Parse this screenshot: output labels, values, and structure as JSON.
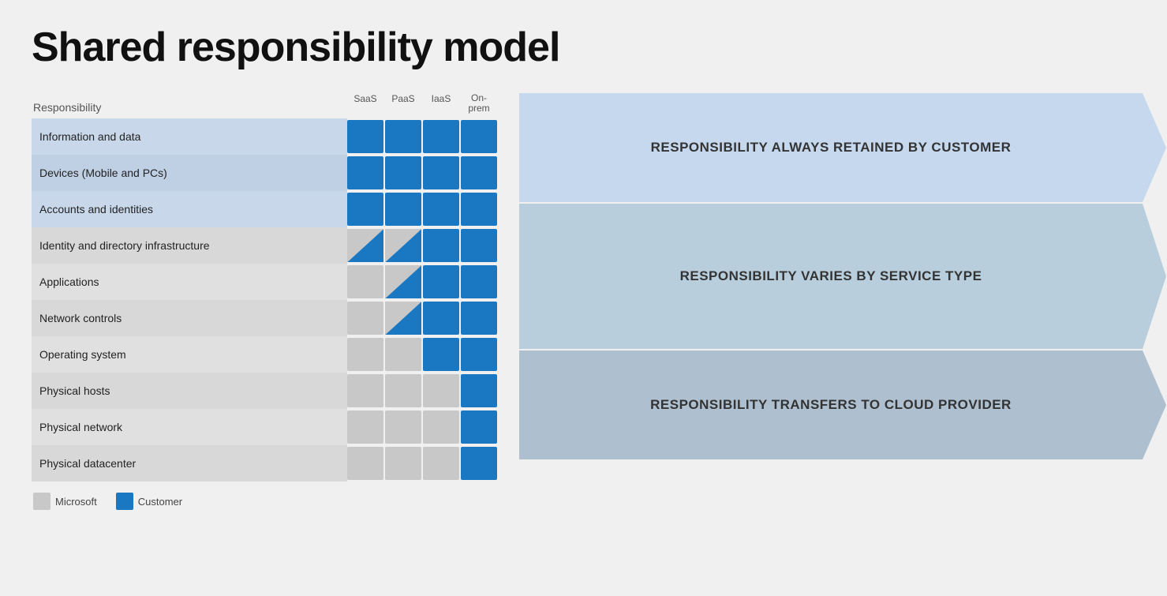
{
  "title": "Shared responsibility model",
  "table": {
    "header": {
      "responsibility_label": "Responsibility",
      "columns": [
        "SaaS",
        "PaaS",
        "IaaS",
        "On-\nprem"
      ]
    },
    "rows": [
      {
        "label": "Information and data",
        "cells": [
          "blue",
          "blue",
          "blue",
          "blue"
        ],
        "bg": "light-blue"
      },
      {
        "label": "Devices (Mobile and PCs)",
        "cells": [
          "blue",
          "blue",
          "blue",
          "blue"
        ],
        "bg": "light-blue"
      },
      {
        "label": "Accounts and identities",
        "cells": [
          "blue",
          "blue",
          "blue",
          "blue"
        ],
        "bg": "light-blue"
      },
      {
        "label": "Identity and directory infrastructure",
        "cells": [
          "half",
          "half",
          "blue",
          "blue"
        ],
        "bg": "light-gray"
      },
      {
        "label": "Applications",
        "cells": [
          "gray",
          "half",
          "blue",
          "blue"
        ],
        "bg": "light-gray"
      },
      {
        "label": "Network controls",
        "cells": [
          "gray",
          "half",
          "blue",
          "blue"
        ],
        "bg": "light-gray"
      },
      {
        "label": "Operating system",
        "cells": [
          "gray",
          "gray",
          "blue",
          "blue"
        ],
        "bg": "light-gray"
      },
      {
        "label": "Physical hosts",
        "cells": [
          "gray",
          "gray",
          "gray",
          "blue"
        ],
        "bg": "light-gray"
      },
      {
        "label": "Physical network",
        "cells": [
          "gray",
          "gray",
          "gray",
          "blue"
        ],
        "bg": "light-gray"
      },
      {
        "label": "Physical datacenter",
        "cells": [
          "gray",
          "gray",
          "gray",
          "blue"
        ],
        "bg": "light-gray"
      }
    ]
  },
  "arrows": [
    {
      "id": "arrow1",
      "text": "RESPONSIBILITY ALWAYS RETAINED BY CUSTOMER",
      "rows": 3,
      "color": "#c5d8ed"
    },
    {
      "id": "arrow2",
      "text": "RESPONSIBILITY VARIES BY SERVICE TYPE",
      "rows": 4,
      "color": "#baccde"
    },
    {
      "id": "arrow3",
      "text": "RESPONSIBILITY TRANSFERS TO CLOUD PROVIDER",
      "rows": 3,
      "color": "#aebfcf"
    }
  ],
  "legend": {
    "items": [
      {
        "id": "microsoft",
        "color": "gray",
        "label": "Microsoft"
      },
      {
        "id": "customer",
        "color": "blue",
        "label": "Customer"
      }
    ]
  }
}
